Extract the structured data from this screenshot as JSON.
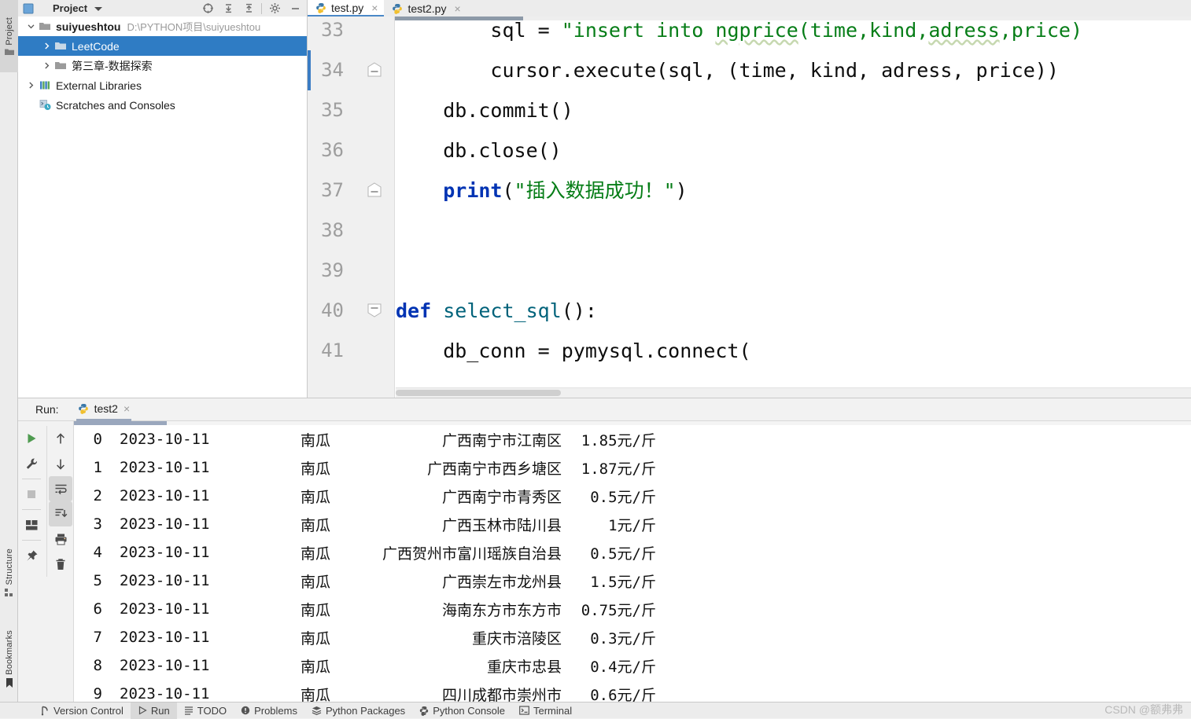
{
  "ide": {
    "left_toolwindows": [
      {
        "label": "Project",
        "icon": "folder-icon",
        "active": true
      },
      {
        "label": "Structure",
        "icon": "structure-icon",
        "active": false
      },
      {
        "label": "Bookmarks",
        "icon": "bookmark-icon",
        "active": false
      }
    ]
  },
  "project_panel": {
    "title": "Project",
    "header_icons": [
      {
        "name": "select-opened-file-icon"
      },
      {
        "name": "expand-all-icon"
      },
      {
        "name": "collapse-all-icon"
      },
      {
        "name": "gear-icon"
      },
      {
        "name": "minimize-icon"
      }
    ],
    "tree": [
      {
        "label": "suiyueshtou",
        "path": "D:\\PYTHON项目\\suiyueshtou",
        "icon": "folder-icon",
        "arrow": "down",
        "indent": 0,
        "bold": true,
        "selected": false
      },
      {
        "label": "LeetCode",
        "path": "",
        "icon": "folder-icon",
        "arrow": "right",
        "indent": 1,
        "bold": false,
        "selected": true
      },
      {
        "label": "第三章-数据探索",
        "path": "",
        "icon": "folder-icon",
        "arrow": "right",
        "indent": 1,
        "bold": false,
        "selected": false
      },
      {
        "label": "External Libraries",
        "path": "",
        "icon": "library-icon",
        "arrow": "right",
        "indent": 0,
        "bold": false,
        "selected": false
      },
      {
        "label": "Scratches and Consoles",
        "path": "",
        "icon": "scratches-icon",
        "arrow": "none",
        "indent": 0,
        "bold": false,
        "selected": false
      }
    ]
  },
  "editor": {
    "tabs": [
      {
        "label": "test.py",
        "icon": "python-file-icon",
        "active": true
      },
      {
        "label": "test2.py",
        "icon": "python-file-icon",
        "active": false
      }
    ],
    "lines": [
      {
        "num": "33",
        "fold": "none",
        "caret": false,
        "segments": [
          {
            "t": "        sql = ",
            "c": "pl"
          },
          {
            "t": "\"insert into ",
            "c": "str"
          },
          {
            "t": "ngprice",
            "c": "str typo"
          },
          {
            "t": "(time,kind,",
            "c": "str"
          },
          {
            "t": "adress",
            "c": "str typo"
          },
          {
            "t": ",price)",
            "c": "str"
          }
        ]
      },
      {
        "num": "34",
        "fold": "end",
        "caret": true,
        "segments": [
          {
            "t": "        cursor.execute(sql, (time, kind, adress, price))",
            "c": "pl"
          }
        ]
      },
      {
        "num": "35",
        "fold": "none",
        "caret": false,
        "segments": [
          {
            "t": "    db.commit()",
            "c": "pl"
          }
        ]
      },
      {
        "num": "36",
        "fold": "none",
        "caret": false,
        "segments": [
          {
            "t": "    db.close()",
            "c": "pl"
          }
        ]
      },
      {
        "num": "37",
        "fold": "end",
        "caret": false,
        "segments": [
          {
            "t": "    ",
            "c": "pl"
          },
          {
            "t": "print",
            "c": "kw"
          },
          {
            "t": "(",
            "c": "pl"
          },
          {
            "t": "\"插入数据成功！\"",
            "c": "str"
          },
          {
            "t": ")",
            "c": "pl"
          }
        ]
      },
      {
        "num": "38",
        "fold": "none",
        "caret": false,
        "segments": [
          {
            "t": "",
            "c": "pl"
          }
        ]
      },
      {
        "num": "39",
        "fold": "none",
        "caret": false,
        "segments": [
          {
            "t": "",
            "c": "pl"
          }
        ]
      },
      {
        "num": "40",
        "fold": "start",
        "caret": false,
        "segments": [
          {
            "t": "def ",
            "c": "kw"
          },
          {
            "t": "select_sql",
            "c": "fn"
          },
          {
            "t": "():",
            "c": "pl"
          }
        ]
      },
      {
        "num": "41",
        "fold": "none",
        "caret": false,
        "segments": [
          {
            "t": "    db_conn = pymysql.connect(",
            "c": "pl"
          }
        ]
      }
    ]
  },
  "run_panel": {
    "label": "Run:",
    "tab": {
      "name": "test2",
      "icon": "python-file-icon",
      "close": "×"
    },
    "tools_left": [
      {
        "name": "rerun-button",
        "icon": "play-icon"
      },
      {
        "name": "stop-button",
        "icon": "stop-icon"
      },
      {
        "name": "layout-button",
        "icon": "layout-icon"
      },
      {
        "name": "pin-tab-button",
        "icon": "pin-icon"
      }
    ],
    "tools_right": [
      {
        "name": "prev-occurrence-button",
        "icon": "arrow-up-icon"
      },
      {
        "name": "next-occurrence-button",
        "icon": "arrow-down-icon"
      },
      {
        "name": "soft-wrap-button",
        "icon": "soft-wrap-icon",
        "active": true
      },
      {
        "name": "scroll-to-end-button",
        "icon": "scroll-to-end-icon",
        "active": true
      },
      {
        "name": "print-button",
        "icon": "printer-icon"
      },
      {
        "name": "clear-all-button",
        "icon": "trash-icon"
      }
    ],
    "console_rows": [
      {
        "idx": "0",
        "date": "2023-10-11",
        "kind": "南瓜",
        "address": "广西南宁市江南区",
        "price": "1.85元/斤"
      },
      {
        "idx": "1",
        "date": "2023-10-11",
        "kind": "南瓜",
        "address": "广西南宁市西乡塘区",
        "price": "1.87元/斤"
      },
      {
        "idx": "2",
        "date": "2023-10-11",
        "kind": "南瓜",
        "address": "广西南宁市青秀区",
        "price": "0.5元/斤"
      },
      {
        "idx": "3",
        "date": "2023-10-11",
        "kind": "南瓜",
        "address": "广西玉林市陆川县",
        "price": "1元/斤"
      },
      {
        "idx": "4",
        "date": "2023-10-11",
        "kind": "南瓜",
        "address": "广西贺州市富川瑶族自治县",
        "price": "0.5元/斤"
      },
      {
        "idx": "5",
        "date": "2023-10-11",
        "kind": "南瓜",
        "address": "广西崇左市龙州县",
        "price": "1.5元/斤"
      },
      {
        "idx": "6",
        "date": "2023-10-11",
        "kind": "南瓜",
        "address": "海南东方市东方市",
        "price": "0.75元/斤"
      },
      {
        "idx": "7",
        "date": "2023-10-11",
        "kind": "南瓜",
        "address": "重庆市涪陵区",
        "price": "0.3元/斤"
      },
      {
        "idx": "8",
        "date": "2023-10-11",
        "kind": "南瓜",
        "address": "重庆市忠县",
        "price": "0.4元/斤"
      },
      {
        "idx": "9",
        "date": "2023-10-11",
        "kind": "南瓜",
        "address": "四川成都市崇州市",
        "price": "0.6元/斤"
      }
    ]
  },
  "statusbar": {
    "items": [
      {
        "label": "Version Control",
        "icon": "vcs-icon",
        "active": false
      },
      {
        "label": "Run",
        "icon": "play-icon",
        "active": true
      },
      {
        "label": "TODO",
        "icon": "todo-icon",
        "active": false
      },
      {
        "label": "Problems",
        "icon": "problems-icon",
        "active": false
      },
      {
        "label": "Python Packages",
        "icon": "packages-icon",
        "active": false
      },
      {
        "label": "Python Console",
        "icon": "python-console-icon",
        "active": false
      },
      {
        "label": "Terminal",
        "icon": "terminal-icon",
        "active": false
      }
    ],
    "watermark": "CSDN @额弗弗"
  },
  "colors": {
    "selection_blue": "#2f7cc4",
    "string_green": "#067d17",
    "keyword_blue": "#0033b3",
    "function_teal": "#00627a",
    "panel_gray": "#ececec"
  }
}
